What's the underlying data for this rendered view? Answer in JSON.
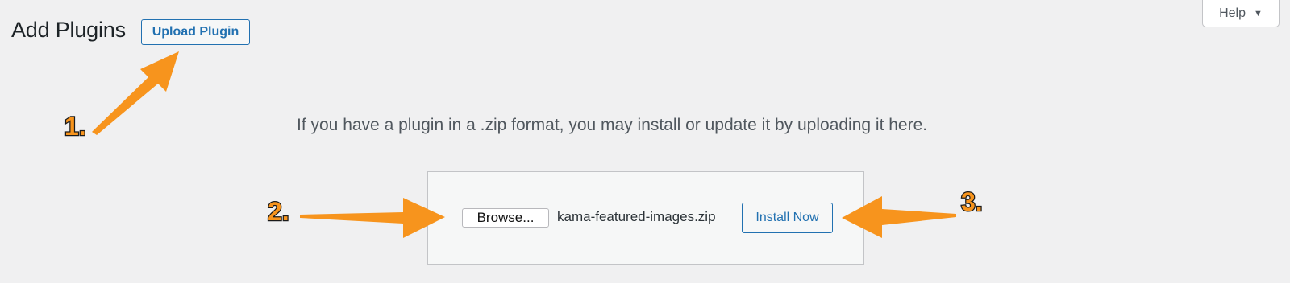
{
  "header": {
    "title": "Add Plugins",
    "upload_label": "Upload Plugin",
    "help_label": "Help"
  },
  "upload": {
    "intro_text": "If you have a plugin in a .zip format, you may install or update it by uploading it here.",
    "browse_label": "Browse...",
    "file_name": "kama-featured-images.zip",
    "install_label": "Install Now"
  },
  "annotations": {
    "steps": [
      "1.",
      "2.",
      "3."
    ],
    "arrow_color": "#f7941d"
  },
  "colors": {
    "accent": "#2271b1",
    "background": "#f0f0f1"
  }
}
